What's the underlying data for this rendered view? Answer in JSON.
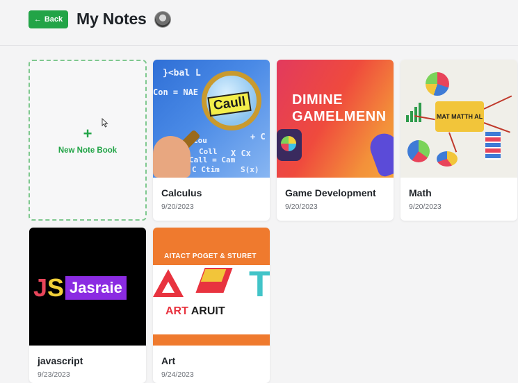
{
  "header": {
    "back_label": "Back",
    "back_icon": "arrow-left-icon",
    "title": "My Notes",
    "avatar_icon": "user-avatar"
  },
  "colors": {
    "accent": "#22a447",
    "background": "#f4f4f5"
  },
  "new_notebook": {
    "icon": "plus-icon",
    "plus_glyph": "+",
    "label": "New Note Book"
  },
  "notebooks": [
    {
      "name": "Calculus",
      "date": "9/20/2023",
      "thumb_text": {
        "formula1": "}<bal L",
        "formula2": "Con = NAE",
        "formula3": "Cou",
        "formula4": "Coll",
        "formula5": "X Cx",
        "formula6": "+ C",
        "formula7": "Call = Cam",
        "formula8": "C Ctim",
        "formula9": "S(x)",
        "magnifier": "Caull"
      }
    },
    {
      "name": "Game Development",
      "date": "9/20/2023",
      "thumb_text": {
        "line1": "DIMINE",
        "line2": "GAMELMENN"
      }
    },
    {
      "name": "Math",
      "date": "9/20/2023",
      "thumb_text": {
        "center": "MAT MATTH AL"
      }
    },
    {
      "name": "javascript",
      "date": "9/23/2023",
      "thumb_text": {
        "js_j": "J",
        "js_s": "S",
        "badge": "Jasraie"
      }
    },
    {
      "name": "Art",
      "date": "9/24/2023",
      "thumb_text": {
        "topline": "AITACT POGET & STURET",
        "letter_t": "T",
        "name_red": "ART",
        "name_black": "ARUIT"
      }
    }
  ]
}
